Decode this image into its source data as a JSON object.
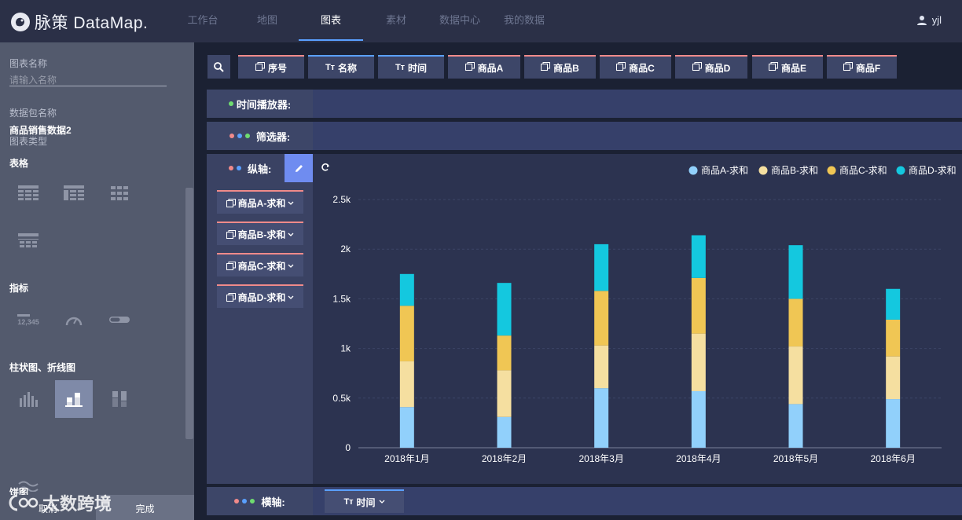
{
  "app": {
    "brand": "脉策 DataMap.",
    "user": "yjl"
  },
  "nav": [
    {
      "label": "工作台",
      "active": false
    },
    {
      "label": "地图",
      "active": false
    },
    {
      "label": "图表",
      "active": true
    },
    {
      "label": "素材",
      "active": false
    },
    {
      "label": "数据中心",
      "active": false
    },
    {
      "label": "我的数据",
      "active": false
    }
  ],
  "left_panel": {
    "chart_name_label": "图表名称",
    "chart_name_placeholder": "请输入名称",
    "package_label": "数据包名称",
    "package_value": "商品销售数据2",
    "chart_type_label": "图表类型",
    "section_table": "表格",
    "section_indicator": "指标",
    "indicator_sample": "12,345",
    "section_bar_line": "柱状图、折线图",
    "section_pie": "饼图",
    "cancel": "取消",
    "done": "完成"
  },
  "watermark": "太数跨境",
  "fields": [
    {
      "icon": "dimension-icon",
      "label": "序号"
    },
    {
      "icon": "text-icon",
      "label": "名称"
    },
    {
      "icon": "text-icon",
      "label": "时间"
    },
    {
      "icon": "dimension-icon",
      "label": "商品A"
    },
    {
      "icon": "dimension-icon",
      "label": "商品B"
    },
    {
      "icon": "dimension-icon",
      "label": "商品C"
    },
    {
      "icon": "dimension-icon",
      "label": "商品D"
    },
    {
      "icon": "dimension-icon",
      "label": "商品E"
    },
    {
      "icon": "dimension-icon",
      "label": "商品F"
    }
  ],
  "rows": {
    "player": "时间播放器:",
    "filter": "筛选器:",
    "yaxis": "纵轴:",
    "xaxis": "横轴:"
  },
  "measures": [
    "商品A-求和",
    "商品B-求和",
    "商品C-求和",
    "商品D-求和"
  ],
  "xaxis_field": "时间",
  "colors": {
    "a": "#91d0fb",
    "b": "#f5dfa0",
    "c": "#f0c654",
    "d": "#14c8df",
    "accent": "#5aa0ff",
    "dim_line": "#f08a8a"
  },
  "chart_data": {
    "type": "bar",
    "stacked": true,
    "categories": [
      "2018年1月",
      "2018年2月",
      "2018年3月",
      "2018年4月",
      "2018年5月",
      "2018年6月"
    ],
    "series": [
      {
        "name": "商品A-求和",
        "values": [
          410,
          310,
          600,
          570,
          440,
          490
        ]
      },
      {
        "name": "商品B-求和",
        "values": [
          460,
          470,
          430,
          580,
          580,
          430
        ]
      },
      {
        "name": "商品C-求和",
        "values": [
          560,
          350,
          550,
          560,
          480,
          370
        ]
      },
      {
        "name": "商品D-求和",
        "values": [
          320,
          530,
          470,
          430,
          540,
          310
        ]
      }
    ],
    "ylim": [
      0,
      2500
    ],
    "yticks": [
      "0",
      "0.5k",
      "1k",
      "1.5k",
      "2k",
      "2.5k"
    ],
    "legend_position": "top-right",
    "grid": true
  }
}
